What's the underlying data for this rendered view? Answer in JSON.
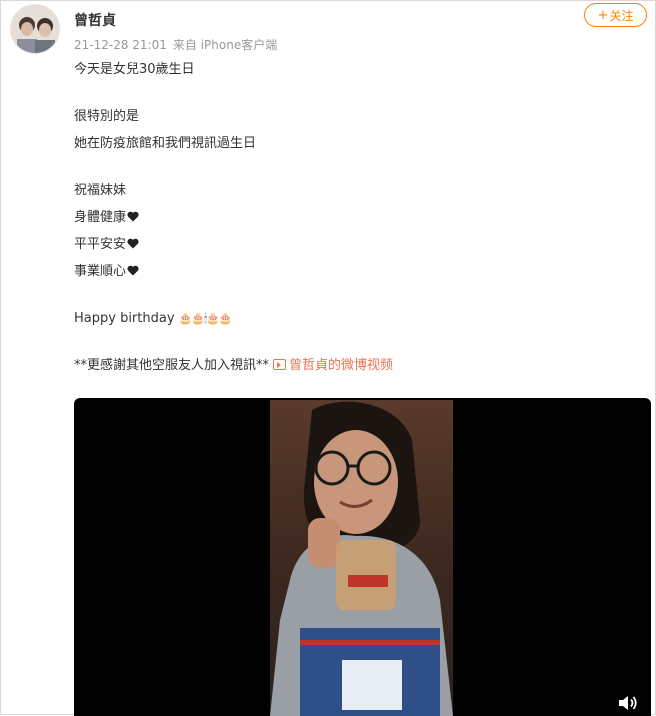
{
  "user": {
    "name": "曾哲貞"
  },
  "post_meta": {
    "timestamp": "21-12-28 21:01",
    "source": "来自 iPhone客户端"
  },
  "follow": {
    "label": "关注",
    "icon": "plus-icon"
  },
  "post": {
    "l1": "今天是女兒30歲生日",
    "l2": "很特別的是",
    "l3": "她在防疫旅館和我們視訊過生日",
    "l4": "祝福妹妹",
    "l5": "身體健康",
    "l6": "平平安安",
    "l7": "事業順心",
    "l8": "Happy birthday",
    "l9": "**更感謝其他空服友人加入視訊**",
    "video_link": "曾哲貞的微博视频"
  },
  "video_player": {
    "icon": "volume-icon",
    "background": "#000000"
  },
  "colors": {
    "accent": "#ff8200",
    "link": "#eb7350",
    "muted": "#999999"
  }
}
